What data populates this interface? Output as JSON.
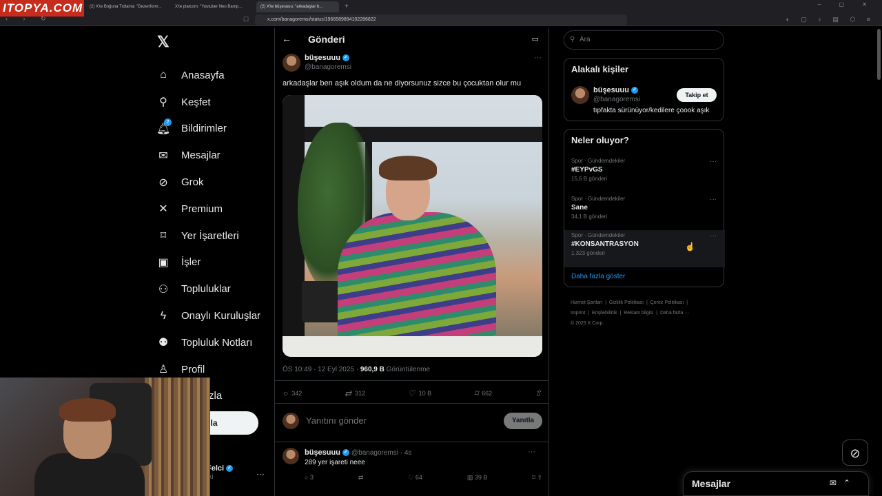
{
  "watermark": "ITOPYA.COM",
  "browser": {
    "tabs": [
      "(2) X'te Boğuna Tıdlama: \"Dezenform...",
      "X'te platcom: \"Youtuber Neo Bamp...",
      "(2) X'te büşesuuu: \"arkadaşlar b..."
    ],
    "url": "x.com/banagoremsi/status/1966589894102286822",
    "new_tab": "+"
  },
  "nav": {
    "items": [
      {
        "label": "Anasayfa",
        "icon": "home-icon"
      },
      {
        "label": "Keşfet",
        "icon": "search-icon"
      },
      {
        "label": "Bildirimler",
        "icon": "bell-icon",
        "badge": "2"
      },
      {
        "label": "Mesajlar",
        "icon": "mail-icon"
      },
      {
        "label": "Grok",
        "icon": "grok-icon"
      },
      {
        "label": "Premium",
        "icon": "x-icon"
      },
      {
        "label": "Yer İşaretleri",
        "icon": "bookmark-icon"
      },
      {
        "label": "İşler",
        "icon": "briefcase-icon"
      },
      {
        "label": "Topluluklar",
        "icon": "people-icon"
      },
      {
        "label": "Onaylı Kuruluşlar",
        "icon": "lightning-icon"
      },
      {
        "label": "Topluluk Notları",
        "icon": "notes-icon"
      },
      {
        "label": "Profil",
        "icon": "person-icon"
      },
      {
        "label": "zla",
        "icon": ""
      }
    ],
    "post_button": "ayınla",
    "account_name": "Felci",
    "account_handle": "ixi"
  },
  "main": {
    "title": "Gönderi",
    "tweet": {
      "name": "büşesuuu",
      "handle": "@banagoremsi",
      "text": "arkadaşlar ben aşık oldum da ne diyorsunuz sizce bu çocuktan olur mu",
      "time": "ÖS 10:49 · 12 Eyl 2025 · ",
      "views_count": "960,9 B",
      "views_label": " Görüntülenme",
      "replies": "342",
      "retweets": "312",
      "likes": "10 B",
      "bookmarks": "662"
    },
    "reply_placeholder": "Yanıtını gönder",
    "reply_button": "Yanıtla",
    "reply2": {
      "name": "büşesuuu",
      "handle": "@banagoremsi · 4s",
      "text": "289 yer işareti neee",
      "replies": "3",
      "likes": "64",
      "views": "39 B"
    }
  },
  "right": {
    "search_placeholder": "Ara",
    "relevant_title": "Alakalı kişiler",
    "person": {
      "name": "büşesuuu",
      "handle": "@banagoremsi",
      "bio": "tıpfakta sürünüyor/kedilere çoook aşık",
      "follow": "Takip et"
    },
    "trends_title": "Neler oluyor?",
    "trends": [
      {
        "category": "Spor · Gündemdekiler",
        "name": "#EYPvGS",
        "count": "15,6 B gönderi"
      },
      {
        "category": "Spor · Gündemdekiler",
        "name": "Sane",
        "count": "34,1 B gönderi"
      },
      {
        "category": "Spor · Gündemdekiler",
        "name": "#KONSANTRASYON",
        "count": "1.323 gönderi"
      }
    ],
    "show_more": "Daha fazla göster",
    "footer": [
      "Hizmet Şartları",
      "|",
      "Gizlilik Politikası",
      "|",
      "Çerez Politikası",
      "|",
      "Imprint",
      "|",
      "Erişilebilirlik",
      "|",
      "Reklam bilgisi",
      "|",
      "Daha fazla ···",
      "© 2025 X Corp."
    ]
  },
  "messages_bar": "Mesajlar"
}
